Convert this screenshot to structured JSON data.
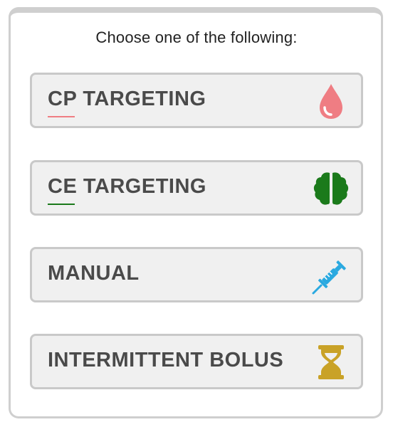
{
  "prompt": "Choose one of the following:",
  "options": [
    {
      "id": "cp",
      "label": "CP TARGETING",
      "icon": "blood-drop-icon",
      "accent": "#ef7d83"
    },
    {
      "id": "ce",
      "label": "CE TARGETING",
      "icon": "brain-icon",
      "accent": "#1b7a1b"
    },
    {
      "id": "manual",
      "label": "MANUAL",
      "icon": "syringe-icon",
      "accent": "#2aa9e0"
    },
    {
      "id": "bolus",
      "label": "INTERMITTENT BOLUS",
      "icon": "hourglass-icon",
      "accent": "#c9a227"
    }
  ]
}
